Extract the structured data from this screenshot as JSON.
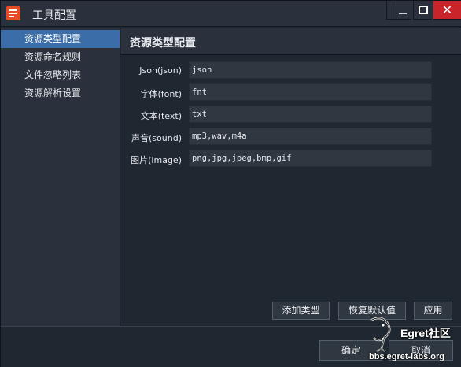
{
  "window": {
    "title": "工具配置",
    "controls": {
      "min": "minimize",
      "max": "maximize",
      "close": "✕"
    }
  },
  "sidebar": {
    "items": [
      {
        "label": "资源类型配置",
        "active": true
      },
      {
        "label": "资源命名规则",
        "active": false
      },
      {
        "label": "文件忽略列表",
        "active": false
      },
      {
        "label": "资源解析设置",
        "active": false
      }
    ]
  },
  "main": {
    "title": "资源类型配置",
    "rows": [
      {
        "label": "Json(json)",
        "value": "json"
      },
      {
        "label": "字体(font)",
        "value": "fnt"
      },
      {
        "label": "文本(text)",
        "value": "txt"
      },
      {
        "label": "声音(sound)",
        "value": "mp3,wav,m4a"
      },
      {
        "label": "图片(image)",
        "value": "png,jpg,jpeg,bmp,gif"
      }
    ],
    "actions": {
      "add_type": "添加类型",
      "restore_default": "恢复默认值",
      "apply": "应用"
    }
  },
  "footer": {
    "ok": "确定",
    "cancel": "取消"
  },
  "watermark": {
    "brand": "Egret社区",
    "url": "bbs.egret-labs.org"
  },
  "colors": {
    "background": "#1f2731",
    "panel": "#2a313c",
    "accent": "#3b6ea8",
    "close": "#c9242a",
    "app_icon": "#e64b2a"
  },
  "icons": {
    "app": "app-config-icon",
    "minimize": "minimize-icon",
    "maximize": "maximize-icon",
    "close": "close-icon"
  }
}
